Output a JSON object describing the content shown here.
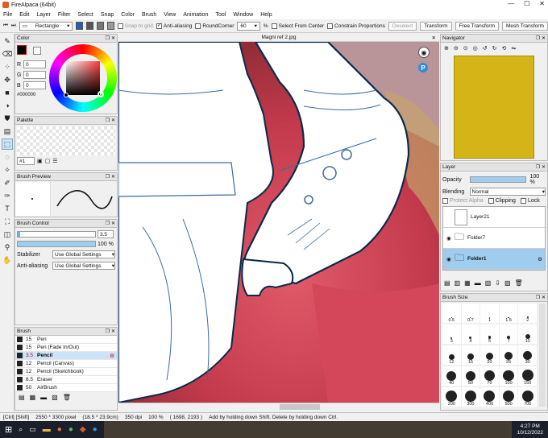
{
  "app": {
    "title": "FireAlpaca (64bit)",
    "window_controls": [
      "—",
      "☐",
      "✕"
    ]
  },
  "menu": [
    "File",
    "Edit",
    "Layer",
    "Filter",
    "Select",
    "Snap",
    "Color",
    "Brush",
    "View",
    "Animation",
    "Tool",
    "Window",
    "Help"
  ],
  "toolbar": {
    "shape": "Rectangle",
    "snap_to_grid": "Snap to grid",
    "anti_aliasing": "Anti-aliasing",
    "round_corner": "RoundCorner",
    "round_corner_value": "60",
    "select_from_center": "Select From Center",
    "constrain": "Constrain Proportions",
    "deselect": "Deselect",
    "transform": "Transform",
    "free_transform": "Free Transform",
    "mesh_transform": "Mesh Transform"
  },
  "document": {
    "tab": "Magni ref 2.jpg"
  },
  "color_panel": {
    "title": "Color",
    "r_label": "R",
    "r": "0",
    "g_label": "G",
    "g": "0",
    "b_label": "B",
    "b": "0",
    "hex": "#000000"
  },
  "palette_panel": {
    "title": "Palette",
    "index": "#1"
  },
  "brush_preview": {
    "title": "Brush Preview"
  },
  "brush_control": {
    "title": "Brush Control",
    "size": "3.5",
    "opacity": "100 %",
    "stabilizer_label": "Stabilizer",
    "stabilizer": "Use Global Settings",
    "antialias_label": "Anti-aliasing",
    "antialias": "Use Global Settings"
  },
  "brush_panel": {
    "title": "Brush",
    "items": [
      {
        "size": "15",
        "name": "Pen"
      },
      {
        "size": "15",
        "name": "Pen (Fade In/Out)"
      },
      {
        "size": "3.5",
        "name": "Pencil"
      },
      {
        "size": "12",
        "name": "Pencil (Canvas)"
      },
      {
        "size": "12",
        "name": "Pencil (Sketchbook)"
      },
      {
        "size": "8.5",
        "name": "Eraser"
      },
      {
        "size": "50",
        "name": "AirBrush"
      }
    ]
  },
  "navigator": {
    "title": "Navigator",
    "canvas_color": "#d4b417"
  },
  "layer_panel": {
    "title": "Layer",
    "opacity_label": "Opacity",
    "opacity": "100 %",
    "blending_label": "Blending",
    "blending": "Normal",
    "protect_alpha": "Protect Alpha",
    "clipping": "Clipping",
    "lock": "Lock",
    "layers": [
      "Layer21",
      "Folder7",
      "Folder1"
    ]
  },
  "brush_size": {
    "title": "Brush Size",
    "sizes": [
      "0.5",
      "0.7",
      "1",
      "1.5",
      "2",
      "3",
      "4",
      "5",
      "7",
      "10",
      "12",
      "15",
      "20",
      "25",
      "30",
      "40",
      "50",
      "70",
      "100",
      "150",
      "200",
      "300",
      "400",
      "500",
      "700"
    ]
  },
  "status": {
    "mods": "[Ctrl] [Shift]",
    "dims": "2550 * 3300 pixel",
    "cm": "(18.5 * 23.9cm)",
    "dpi": "350 dpi",
    "zoom": "100 %",
    "coords": "( 1698, 2193 )",
    "hint": "Add by holding down Shift. Delete by holding down Ctrl."
  },
  "taskbar": {
    "time": "4:27 PM",
    "date": "10/12/2022"
  }
}
